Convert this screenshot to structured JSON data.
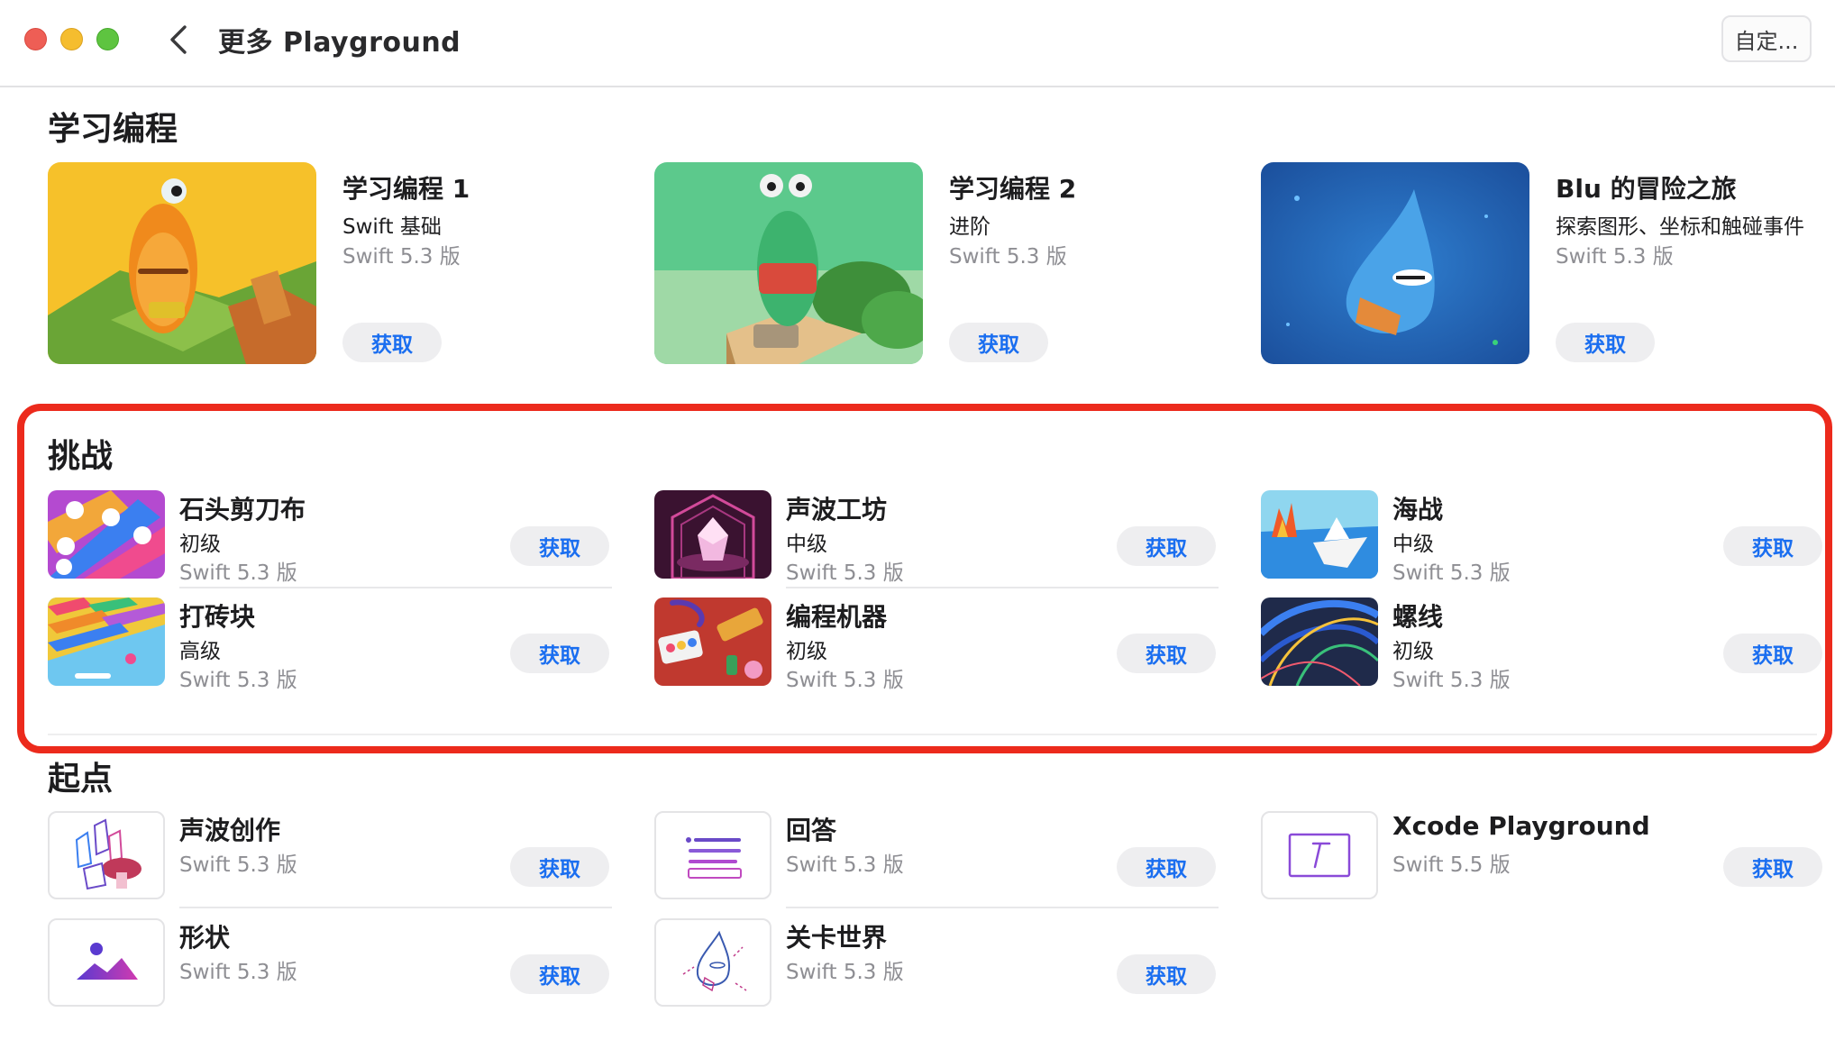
{
  "window": {
    "title": "更多 Playground",
    "customize_label": "自定..."
  },
  "sections": {
    "learn": {
      "title": "学习编程"
    },
    "challenges": {
      "title": "挑战"
    },
    "starting_points": {
      "title": "起点"
    }
  },
  "learn_cards": [
    {
      "title": "学习编程 1",
      "subtitle": "Swift 基础",
      "version": "Swift 5.3 版",
      "get_label": "获取"
    },
    {
      "title": "学习编程 2",
      "subtitle": "进阶",
      "version": "Swift 5.3 版",
      "get_label": "获取"
    },
    {
      "title": "Blu 的冒险之旅",
      "subtitle": "探索图形、坐标和触碰事件",
      "version": "Swift 5.3 版",
      "get_label": "获取"
    }
  ],
  "challenges": [
    {
      "title": "石头剪刀布",
      "level": "初级",
      "version": "Swift 5.3 版",
      "get_label": "获取"
    },
    {
      "title": "声波工坊",
      "level": "中级",
      "version": "Swift 5.3 版",
      "get_label": "获取"
    },
    {
      "title": "海战",
      "level": "中级",
      "version": "Swift 5.3 版",
      "get_label": "获取"
    },
    {
      "title": "打砖块",
      "level": "高级",
      "version": "Swift 5.3 版",
      "get_label": "获取"
    },
    {
      "title": "编程机器",
      "level": "初级",
      "version": "Swift 5.3 版",
      "get_label": "获取"
    },
    {
      "title": "螺线",
      "level": "初级",
      "version": "Swift 5.3 版",
      "get_label": "获取"
    }
  ],
  "starting_points": [
    {
      "title": "声波创作",
      "version": "Swift 5.3 版",
      "get_label": "获取"
    },
    {
      "title": "回答",
      "version": "Swift 5.3 版",
      "get_label": "获取"
    },
    {
      "title": "Xcode Playground",
      "version": "Swift 5.5 版",
      "get_label": "获取"
    },
    {
      "title": "形状",
      "version": "Swift 5.3 版",
      "get_label": "获取"
    },
    {
      "title": "关卡世界",
      "version": "Swift 5.3 版",
      "get_label": "获取"
    }
  ],
  "colors": {
    "accent": "#1a6ef0",
    "highlight": "#ec2a1c",
    "secondary_text": "#8e8e93"
  }
}
